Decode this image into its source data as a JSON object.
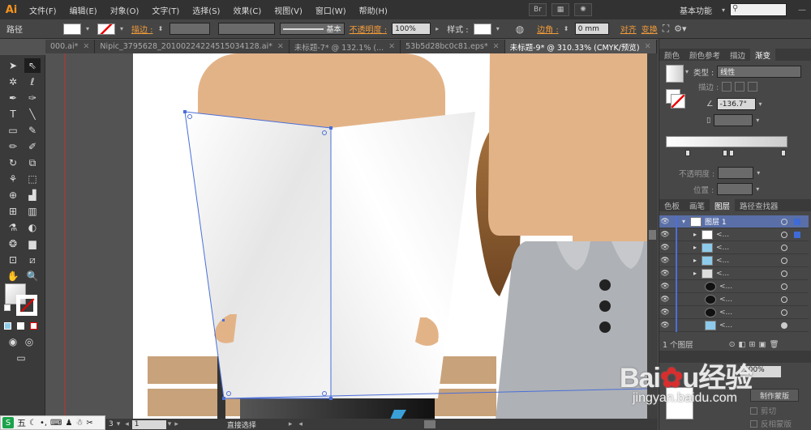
{
  "app": {
    "logo": "Ai"
  },
  "menu": [
    "文件(F)",
    "编辑(E)",
    "对象(O)",
    "文字(T)",
    "选择(S)",
    "效果(C)",
    "视图(V)",
    "窗口(W)",
    "帮助(H)"
  ],
  "menubar_right": {
    "br_label": "Br",
    "workspace": "基本功能",
    "search_placeholder": ""
  },
  "control": {
    "object_type": "路径",
    "stroke_label": "描边 :",
    "stroke_profile": "基本",
    "opacity_label": "不透明度 :",
    "opacity_value": "100%",
    "style_label": "样式 :",
    "corner_label": "边角 :",
    "corner_value": "0 mm",
    "align_label": "对齐",
    "transform_label": "变换"
  },
  "doc_tabs": [
    {
      "label": "000.ai*",
      "active": false
    },
    {
      "label": "Nipic_3795628_20100224224515034128.ai*",
      "active": false
    },
    {
      "label": "未标题-7* @ 132.1% (...",
      "active": false
    },
    {
      "label": "53b5d28bc0c81.eps*",
      "active": false
    },
    {
      "label": "未标题-9* @ 310.33% (CMYK/预览)",
      "active": true
    }
  ],
  "gradient_panel": {
    "tabs": [
      "颜色",
      "颜色参考",
      "描边",
      "渐变"
    ],
    "type_label": "类型 :",
    "type_value": "线性",
    "stroke_label": "描边 :",
    "angle_value": "-136.7°",
    "opacity_label": "不透明度 :",
    "position_label": "位置 :"
  },
  "layers_panel": {
    "tabs": [
      "色板",
      "画笔",
      "图层",
      "路径查找器"
    ],
    "top_layer": "图层 1",
    "sublayer_label": "<...",
    "footer_count": "1 个图层"
  },
  "bottom_panel": {
    "opacity_value": "100%",
    "make_mask_btn": "制作蒙版",
    "clip_label": "剪切",
    "invert_label": "反相蒙版"
  },
  "status": {
    "zoom_suffix": "3",
    "page_num": "1",
    "tool_name": "直接选择"
  },
  "watermark": {
    "brand": "Bai",
    "brand2": "经验",
    "url": "jingyan.baidu.com"
  },
  "taskbar": {
    "ime": "五"
  },
  "colors": {
    "skin": "#e3b388",
    "hair": "#8b5a2b",
    "shirt": "#aeb1b5",
    "bench": "#c8a27a",
    "button_dark": "#222222",
    "selection_blue": "#4a6fd8"
  }
}
